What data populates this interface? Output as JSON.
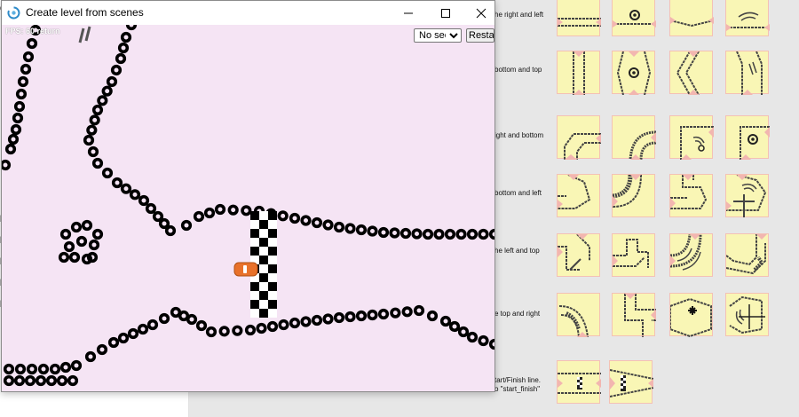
{
  "window": {
    "title": "Create level from scenes",
    "fps_text": "FPS: 60 return"
  },
  "game": {
    "seed_options": [
      "No seed"
    ],
    "seed_selected": "No seed",
    "restart_label": "Restart",
    "background": "#f5e4f4"
  },
  "sidebar_left": {
    "fragments": [
      "d",
      "l",
      "l",
      "l",
      "l",
      "l"
    ]
  },
  "catalog": {
    "rows": [
      {
        "label_lines": [
          "he right and left"
        ]
      },
      {
        "label_lines": [
          "bottom and top"
        ]
      },
      {
        "label_lines": [
          "ight and bottom"
        ]
      },
      {
        "label_lines": [
          "bottom and left"
        ]
      },
      {
        "label_lines": [
          "he left and top"
        ]
      },
      {
        "label_lines": [
          "e top and right"
        ]
      },
      {
        "label_lines": [
          "tart/Finish line.",
          "o \"start_finish\""
        ]
      }
    ],
    "tile_color": "#f9f6b5",
    "tile_border": "#f4c1b5",
    "marker_color": "#f2b6b0"
  },
  "colors": {
    "tire": "#000000",
    "car": "#e8712a",
    "checker_dark": "#000000",
    "checker_light": "#ffffff"
  }
}
